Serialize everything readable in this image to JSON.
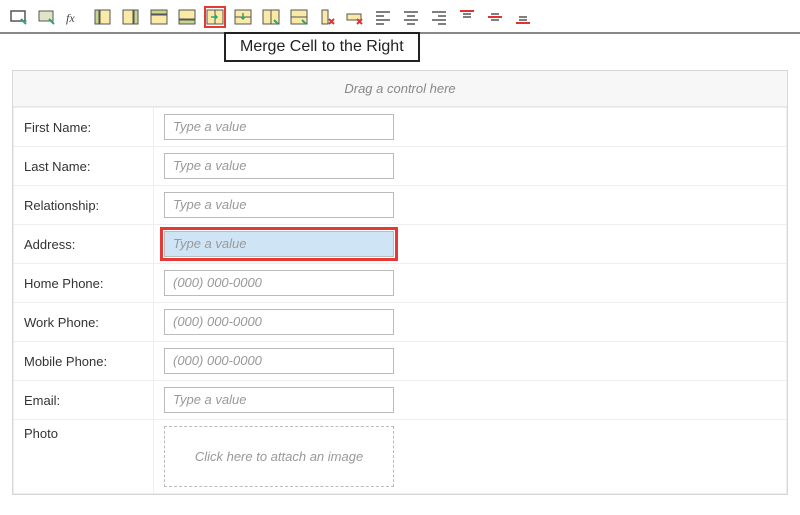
{
  "tooltip": "Merge Cell to the Right",
  "drop_bar": "Drag a control here",
  "toolbar": {
    "buttons": [
      {
        "name": "insert-field-icon"
      },
      {
        "name": "insert-control-icon"
      },
      {
        "name": "formula-icon"
      },
      {
        "name": "insert-column-left-icon"
      },
      {
        "name": "insert-column-right-icon"
      },
      {
        "name": "insert-row-above-icon"
      },
      {
        "name": "insert-row-below-icon"
      },
      {
        "name": "merge-right-icon",
        "highlight": true
      },
      {
        "name": "merge-down-icon"
      },
      {
        "name": "split-horizontal-icon"
      },
      {
        "name": "split-vertical-icon"
      },
      {
        "name": "delete-column-icon"
      },
      {
        "name": "delete-row-icon"
      },
      {
        "name": "align-left-icon"
      },
      {
        "name": "align-center-icon"
      },
      {
        "name": "align-right-icon"
      },
      {
        "name": "valign-top-icon"
      },
      {
        "name": "valign-middle-icon"
      },
      {
        "name": "valign-bottom-icon"
      }
    ]
  },
  "fields": [
    {
      "label": "First Name:",
      "placeholder": "Type a value",
      "name": "first-name-field"
    },
    {
      "label": "Last Name:",
      "placeholder": "Type a value",
      "name": "last-name-field"
    },
    {
      "label": "Relationship:",
      "placeholder": "Type a value",
      "name": "relationship-field"
    },
    {
      "label": "Address:",
      "placeholder": "Type a value",
      "name": "address-field",
      "selected": true
    },
    {
      "label": "Home Phone:",
      "placeholder": "(000) 000-0000",
      "name": "home-phone-field"
    },
    {
      "label": "Work Phone:",
      "placeholder": "(000) 000-0000",
      "name": "work-phone-field"
    },
    {
      "label": "Mobile Phone:",
      "placeholder": "(000) 000-0000",
      "name": "mobile-phone-field"
    },
    {
      "label": "Email:",
      "placeholder": "Type a value",
      "name": "email-field"
    }
  ],
  "photo": {
    "label": "Photo",
    "drop_text": "Click here to attach an image"
  },
  "colors": {
    "highlight": "#e53935",
    "selection_bg": "#cfe5f5"
  }
}
